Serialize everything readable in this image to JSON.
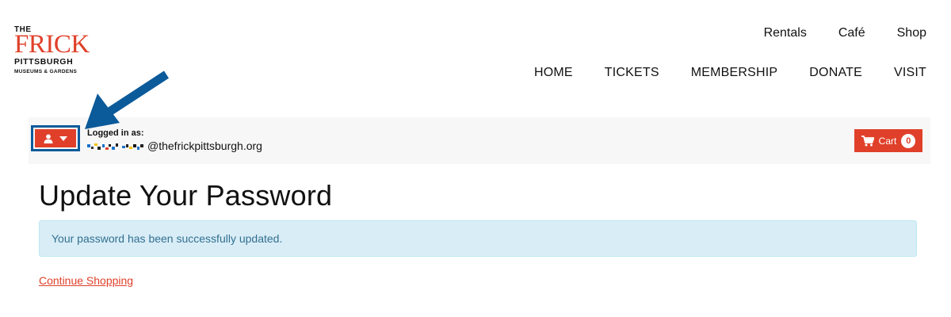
{
  "logo": {
    "line1": "THE",
    "line2": "FRICK",
    "line3": "PITTSBURGH",
    "line4": "MUSEUMS & GARDENS"
  },
  "utility_nav": {
    "items": [
      {
        "label": "Rentals"
      },
      {
        "label": "Café"
      },
      {
        "label": "Shop"
      }
    ]
  },
  "main_nav": {
    "items": [
      {
        "label": "HOME"
      },
      {
        "label": "TICKETS"
      },
      {
        "label": "MEMBERSHIP"
      },
      {
        "label": "DONATE"
      },
      {
        "label": "VISIT"
      }
    ]
  },
  "account": {
    "user_menu_icon": "user-icon",
    "dropdown_icon": "caret-down-icon",
    "logged_in_label": "Logged in as:",
    "email_domain": "@thefrickpittsburgh.org"
  },
  "cart": {
    "icon": "cart-icon",
    "label": "Cart",
    "count": "0"
  },
  "main": {
    "title": "Update Your Password",
    "alert_message": "Your password has been successfully updated.",
    "continue_link": "Continue Shopping"
  },
  "colors": {
    "brand_red": "#e0402a",
    "annotation_blue": "#0b5a9a",
    "alert_bg": "#d9edf7",
    "alert_text": "#31708f"
  }
}
